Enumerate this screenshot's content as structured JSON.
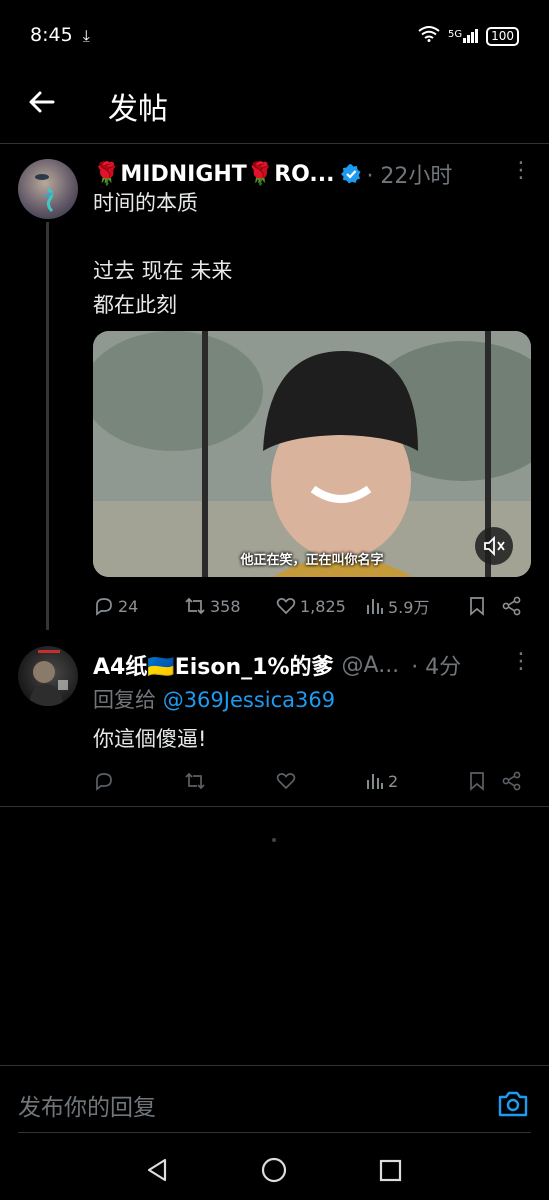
{
  "status_bar": {
    "time": "8:45",
    "network": "5G",
    "battery": "100"
  },
  "header": {
    "title": "发帖"
  },
  "main_post": {
    "name": "🌹MIDNIGHT🌹RO...",
    "time": "· 22小时",
    "text_lines": [
      "时间的本质",
      "",
      "过去 现在 未来",
      "都在此刻"
    ],
    "video_caption": "他正在笑，正在叫你名字",
    "stats": {
      "replies": "24",
      "retweets": "358",
      "likes": "1,825",
      "views": "5.9万"
    }
  },
  "reply_post": {
    "name": "A4纸🇺🇦Eison_1%的爹",
    "handle": "@A...",
    "time": "· 4分",
    "reply_to_label": "回复给",
    "reply_to_handle": "@369Jessica369",
    "text": "你這個傻逼!",
    "stats": {
      "views": "2"
    }
  },
  "composer": {
    "placeholder": "发布你的回复"
  },
  "colors": {
    "accent": "#1d9bf0",
    "background": "#000000",
    "muted": "#71767b"
  }
}
